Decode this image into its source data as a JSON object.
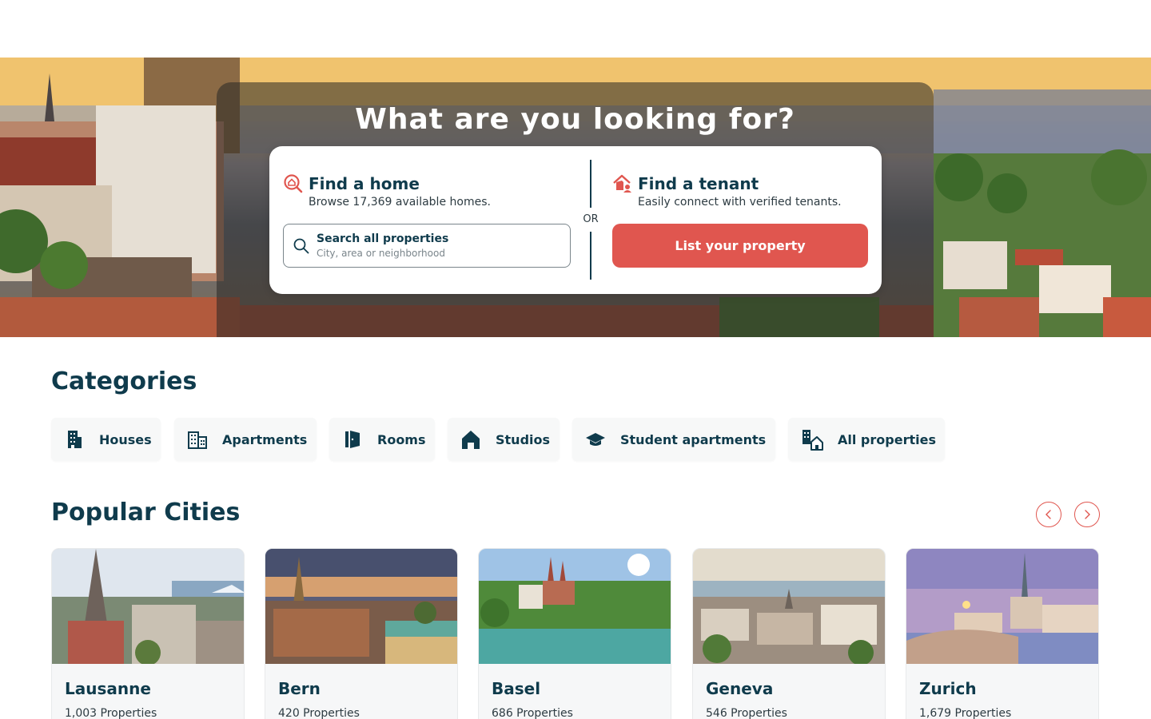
{
  "hero": {
    "title": "What are you looking for?",
    "find_home": {
      "heading": "Find a home",
      "subtitle": "Browse 17,369 available homes.",
      "search_label": "Search all properties",
      "search_placeholder": "City, area or neighborhood"
    },
    "or_label": "OR",
    "find_tenant": {
      "heading": "Find a tenant",
      "subtitle": "Easily connect with verified tenants.",
      "button_label": "List your property"
    }
  },
  "categories": {
    "title": "Categories",
    "items": [
      {
        "label": "Houses",
        "icon": "building-icon"
      },
      {
        "label": "Apartments",
        "icon": "apartment-building-icon"
      },
      {
        "label": "Rooms",
        "icon": "door-icon"
      },
      {
        "label": "Studios",
        "icon": "home-icon"
      },
      {
        "label": "Student apartments",
        "icon": "graduation-cap-icon"
      },
      {
        "label": "All properties",
        "icon": "city-home-icon"
      }
    ]
  },
  "popular_cities": {
    "title": "Popular Cities",
    "items": [
      {
        "name": "Lausanne",
        "count": "1,003 Properties"
      },
      {
        "name": "Bern",
        "count": "420 Properties"
      },
      {
        "name": "Basel",
        "count": "686 Properties"
      },
      {
        "name": "Geneva",
        "count": "546 Properties"
      },
      {
        "name": "Zurich",
        "count": "1,679 Properties"
      }
    ]
  },
  "colors": {
    "primary": "#0f3b4c",
    "accent": "#e0564f"
  }
}
